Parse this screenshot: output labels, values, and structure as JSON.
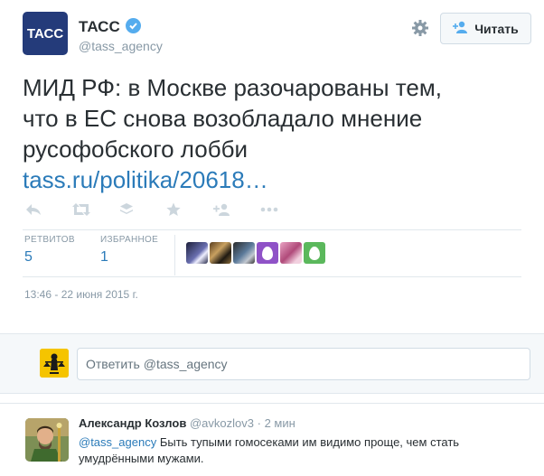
{
  "colors": {
    "accent_link": "#2b7bb9",
    "verified_blue": "#55acee",
    "muted": "#8899a6",
    "tass_brand": "#243b7a",
    "reply_bg": "#f5f8fa"
  },
  "header": {
    "avatar_text": "ТАСС",
    "name": "ТАСС",
    "verified_icon": "verified-badge-icon",
    "screen_name": "@tass_agency",
    "settings_icon": "gear-icon",
    "follow_label": "Читать",
    "follow_icon": "add-user-icon"
  },
  "tweet": {
    "text_lines": [
      "МИД РФ: в Москве разочарованы тем,",
      "что в ЕС снова возобладало мнение",
      "русофобского лобби"
    ],
    "link": "tass.ru/politika/20618…",
    "actions": [
      {
        "name": "reply-icon"
      },
      {
        "name": "retweet-icon"
      },
      {
        "name": "stack-icon"
      },
      {
        "name": "favorite-star-icon"
      },
      {
        "name": "follow-icon"
      },
      {
        "name": "more-icon"
      }
    ],
    "stats": {
      "retweets_label": "РЕТВИТОВ",
      "retweets_value": "5",
      "favorites_label": "ИЗБРАННОЕ",
      "favorites_value": "1"
    },
    "date": "13:46 - 22 июня 2015 г."
  },
  "reply_box": {
    "placeholder": "Ответить @tass_agency"
  },
  "reply": {
    "name": "Александр Козлов",
    "screen_name": "@avkozlov3",
    "time": "2 мин",
    "mention": "@tass_agency",
    "text": " Быть тупыми гомосеками им видимо проще, чем стать умудрёнными мужами."
  }
}
